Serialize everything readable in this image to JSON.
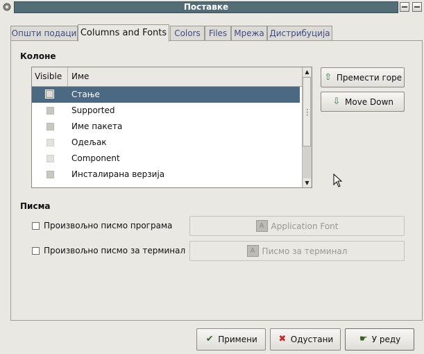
{
  "window": {
    "title": "Поставке"
  },
  "tabs": [
    "Општи подаци",
    "Columns and Fonts",
    "Colors",
    "Files",
    "Мрежа",
    "Дистрибуција"
  ],
  "columns_section": {
    "title": "Колоне",
    "headers": [
      "Visible",
      "Име"
    ],
    "rows": [
      {
        "label": "Стање",
        "selected": true
      },
      {
        "label": "Supported",
        "selected": false
      },
      {
        "label": "Име пакета",
        "selected": false
      },
      {
        "label": "Одељак",
        "selected": false
      },
      {
        "label": "Component",
        "selected": false
      },
      {
        "label": "Инсталирана верзија",
        "selected": false
      }
    ],
    "move_up_label": "Премести горе",
    "move_down_label": "Move Down"
  },
  "fonts_section": {
    "title": "Писма",
    "program_font_checkbox": "Произвољно писмо програма",
    "terminal_font_checkbox": "Произвољно писмо за терминал",
    "application_font_button": "Application Font",
    "terminal_font_button": "Писмо за терминал"
  },
  "footer": {
    "apply_label": "Примени",
    "cancel_label": "Одустани",
    "ok_label": "У реду"
  },
  "icons": {
    "move_up": "arrow-up-icon",
    "move_down": "arrow-down-icon",
    "font": "font-icon",
    "apply": "checkmark-icon",
    "cancel": "cross-icon",
    "ok": "ok-hand-icon"
  },
  "colors": {
    "titlebar": "#536d77",
    "selection": "#4b6983",
    "background": "#eae8e3"
  }
}
